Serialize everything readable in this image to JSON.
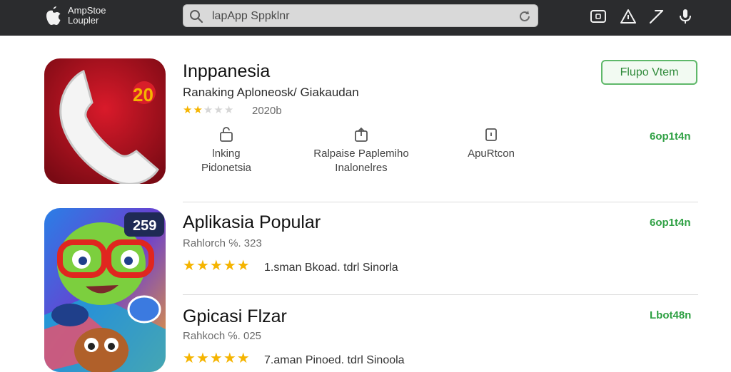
{
  "topbar": {
    "brand_line1": "AmpStoe",
    "brand_line2": "Loupler",
    "search_query": "lapApp Sppklnr"
  },
  "featured": {
    "title": "Inppanesia",
    "subtitle": "Ranaking Aploneosk/ Giakaudan",
    "rating_stars": 2,
    "rating_count": "2020b",
    "action_button": "Flupo Vtem",
    "install_label": "6op1t4n",
    "icon_badge": "20",
    "features": [
      {
        "line1": "lnking",
        "line2": "Pidonetsia"
      },
      {
        "line1": "Ralpaise Paplemiho",
        "line2": "Inalonelres"
      },
      {
        "line1": "ApuRtcon",
        "line2": ""
      }
    ]
  },
  "list": [
    {
      "title": "Aplikasia Popular",
      "meta": "Rahlorch  ℅. 323",
      "rating_stars": 5,
      "rating_text": "1.sman Bkoad.  tdrl  Sinorla",
      "install_label": "6op1t4n",
      "icon_badge": "259"
    },
    {
      "title": "Gpicasi Flzar",
      "meta": "Rahkoch  ℅. 025",
      "rating_stars": 5,
      "rating_text": "7.aman Pinoed.  tdrl  Sinoola",
      "install_label": "Lbot48n"
    }
  ],
  "colors": {
    "topbar": "#2b2c2e",
    "accent_green": "#2ea043",
    "star": "#f5b400"
  }
}
